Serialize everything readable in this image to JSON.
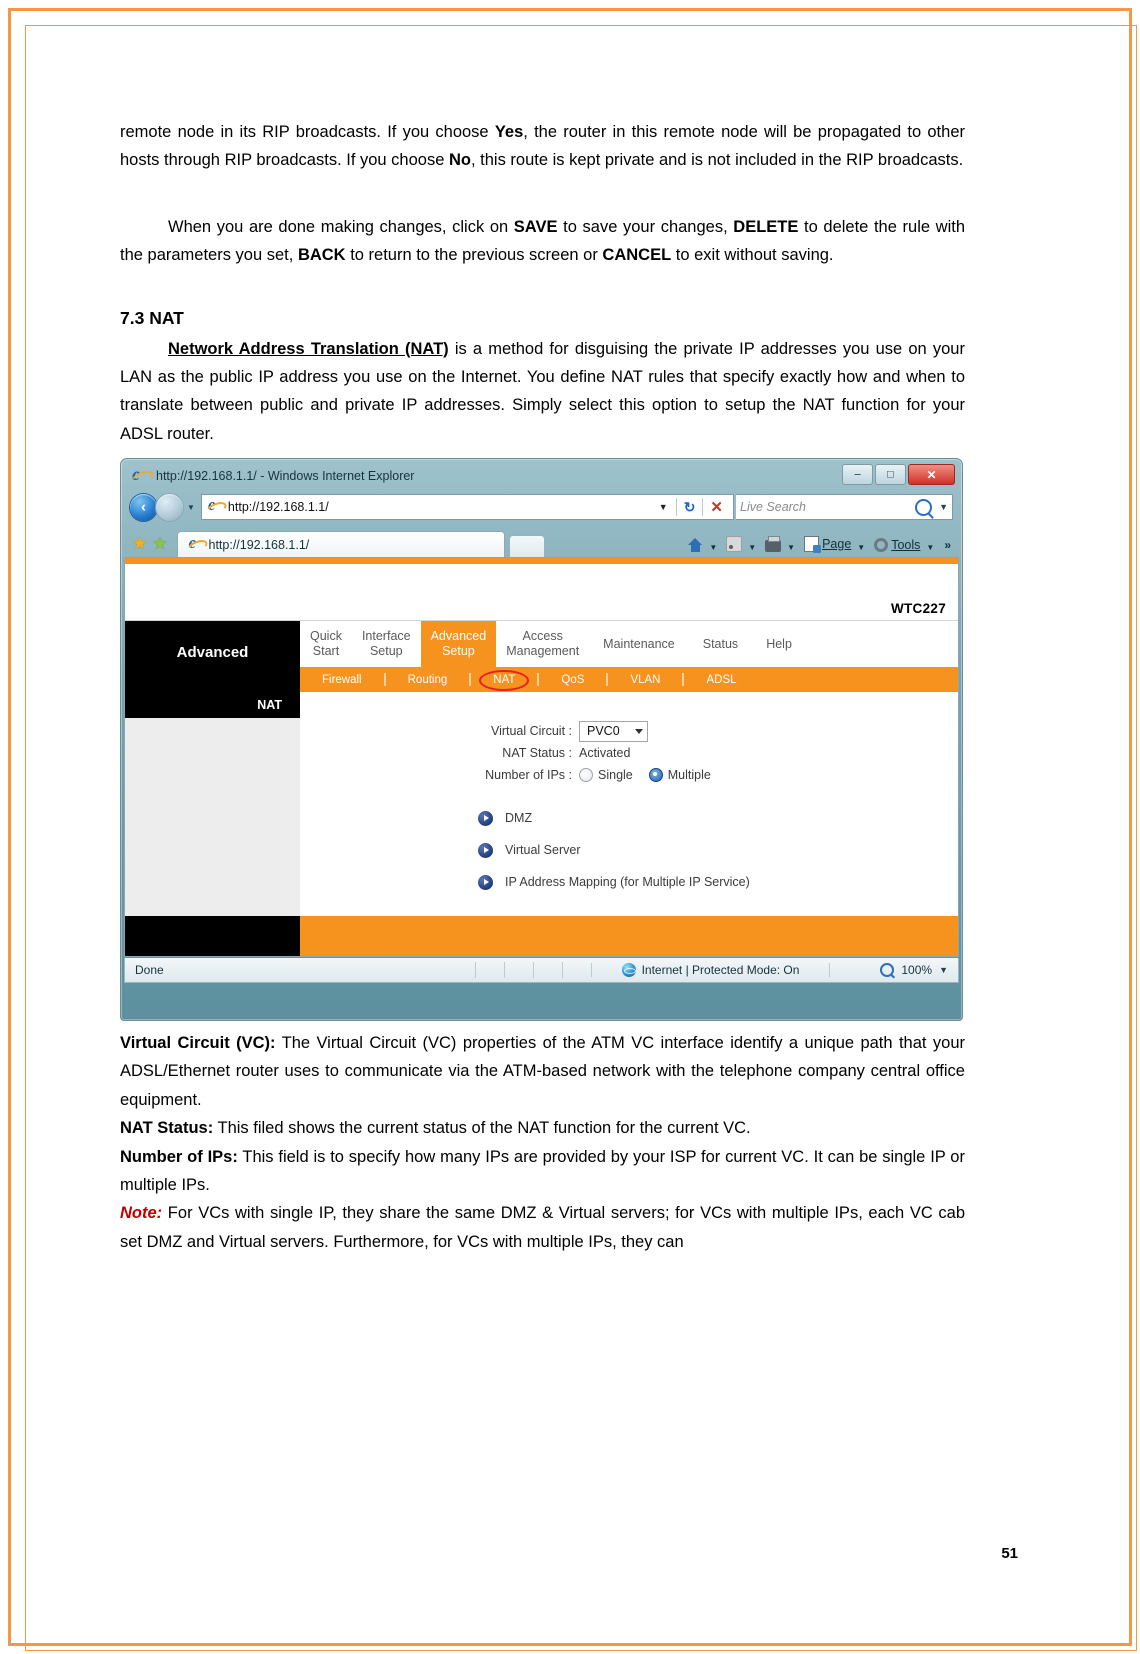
{
  "document": {
    "page_number": "51",
    "paragraph_1": {
      "parts": [
        {
          "t": "remote node in its RIP broadcasts. If you choose ",
          "b": false
        },
        {
          "t": "Yes",
          "b": true
        },
        {
          "t": ", the router in this remote node will be propagated to other hosts through RIP broadcasts. If you choose ",
          "b": false
        },
        {
          "t": "No",
          "b": true
        },
        {
          "t": ", this route is kept private and is not included in the RIP broadcasts.",
          "b": false
        }
      ]
    },
    "paragraph_2": {
      "parts": [
        {
          "t": "When you are done making changes, click on ",
          "b": false
        },
        {
          "t": "SAVE",
          "b": true
        },
        {
          "t": " to save your changes, ",
          "b": false
        },
        {
          "t": "DELETE",
          "b": true
        },
        {
          "t": " to delete the rule with the parameters you set, ",
          "b": false
        },
        {
          "t": "BACK",
          "b": true
        },
        {
          "t": " to return to the previous screen or ",
          "b": false
        },
        {
          "t": "CANCEL",
          "b": true
        },
        {
          "t": " to exit without saving.",
          "b": false
        }
      ]
    },
    "section_heading": "7.3 NAT",
    "paragraph_3": {
      "parts": [
        {
          "t": "Network Address Translation (NAT)",
          "b": true,
          "u": true
        },
        {
          "t": " is a method for disguising the private IP addresses you use on your LAN as the public IP address you use on the Internet. You define NAT rules that specify exactly how and when to translate between public and private IP addresses. Simply select this option to setup the NAT function for your ADSL router.",
          "b": false
        }
      ]
    },
    "definitions": [
      {
        "term": "Virtual Circuit (VC):",
        "text": " The Virtual Circuit (VC) properties of the ATM VC interface identify a unique path that your ADSL/Ethernet router uses to communicate via the ATM-based network with the telephone company central office equipment."
      },
      {
        "term": "NAT Status:",
        "text": " This filed shows the current status of the NAT function for the current VC."
      },
      {
        "term": "Number of IPs:",
        "text": " This field is to specify how many IPs are provided by your ISP for current VC. It can be single IP or multiple IPs."
      }
    ],
    "note": {
      "label": "Note:",
      "text": " For VCs with single IP, they share the same DMZ & Virtual servers; for VCs with multiple IPs, each VC cab set DMZ and Virtual servers. Furthermore, for VCs with multiple IPs, they can"
    }
  },
  "browser": {
    "title": "http://192.168.1.1/ - Windows Internet Explorer",
    "window_buttons": {
      "minimize": "–",
      "maximize": "□",
      "close": "✕"
    },
    "back_arrow": "‹",
    "forward_arrow": "›",
    "history_caret": "▼",
    "address_value": "http://192.168.1.1/",
    "address_caret": "▼",
    "refresh_glyph": "↻",
    "stop_glyph": "✕",
    "search_placeholder": "Live Search",
    "search_caret": "▼",
    "favorites_star": "★",
    "favorites_add": "★",
    "tab_label": "http://192.168.1.1/",
    "toolbar": {
      "home": "",
      "feeds": "",
      "print": "",
      "page": "Page",
      "tools": "Tools",
      "overflow": "»",
      "caret": "▼"
    },
    "statusbar": {
      "status": "Done",
      "zone": "Internet | Protected Mode: On",
      "zoom": "100%",
      "zoom_caret": "▼"
    }
  },
  "router_ui": {
    "model": "WTC227",
    "sidebar_title": "Advanced",
    "sidebar_section": "NAT",
    "main_tabs": [
      {
        "line1": "Quick",
        "line2": "Start",
        "active": false
      },
      {
        "line1": "Interface",
        "line2": "Setup",
        "active": false
      },
      {
        "line1": "Advanced",
        "line2": "Setup",
        "active": true
      },
      {
        "line1": "Access",
        "line2": "Management",
        "active": false
      },
      {
        "line1": "Maintenance",
        "line2": "",
        "active": false
      },
      {
        "line1": "Status",
        "line2": "",
        "active": false
      },
      {
        "line1": "Help",
        "line2": "",
        "active": false
      }
    ],
    "sub_tabs": [
      {
        "label": "Firewall",
        "highlighted": false
      },
      {
        "label": "Routing",
        "highlighted": false
      },
      {
        "label": "NAT",
        "highlighted": true
      },
      {
        "label": "QoS",
        "highlighted": false
      },
      {
        "label": "VLAN",
        "highlighted": false
      },
      {
        "label": "ADSL",
        "highlighted": false
      }
    ],
    "form": {
      "virtual_circuit_label": "Virtual Circuit :",
      "virtual_circuit_value": "PVC0",
      "nat_status_label": "NAT Status :",
      "nat_status_value": "Activated",
      "number_of_ips_label": "Number of IPs :",
      "radio_single": "Single",
      "radio_multiple": "Multiple",
      "selected_option": "Multiple"
    },
    "links": [
      {
        "label": "DMZ"
      },
      {
        "label": "Virtual Server"
      },
      {
        "label": "IP Address Mapping (for Multiple IP Service)"
      }
    ],
    "colors": {
      "accent_orange": "#F6931E",
      "sidebar_black": "#000000",
      "highlight_red": "#ED1C24",
      "page_border": "#F79646"
    }
  }
}
